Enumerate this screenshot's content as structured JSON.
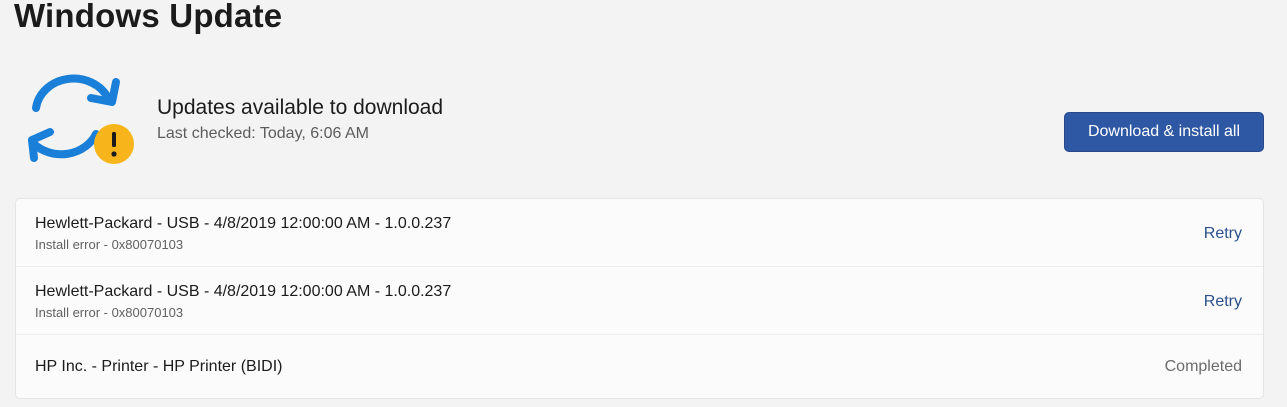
{
  "page": {
    "title": "Windows Update"
  },
  "status": {
    "icon": "sync-warning-icon",
    "title": "Updates available to download",
    "last_checked": "Last checked: Today, 6:06 AM"
  },
  "actions": {
    "download_install_all": "Download & install all"
  },
  "updates": [
    {
      "title": "Hewlett-Packard - USB - 4/8/2019 12:00:00 AM - 1.0.0.237",
      "status": "Install error - 0x80070103",
      "action": "Retry"
    },
    {
      "title": "Hewlett-Packard - USB - 4/8/2019 12:00:00 AM - 1.0.0.237",
      "status": "Install error - 0x80070103",
      "action": "Retry"
    },
    {
      "title": "HP Inc. - Printer - HP Printer (BIDI)",
      "status": "",
      "action": "Completed"
    }
  ],
  "colors": {
    "accent": "#2e58a3",
    "sync_blue": "#1a7fd8",
    "warning_yellow": "#f7b51b",
    "link": "#2b4f8d"
  }
}
